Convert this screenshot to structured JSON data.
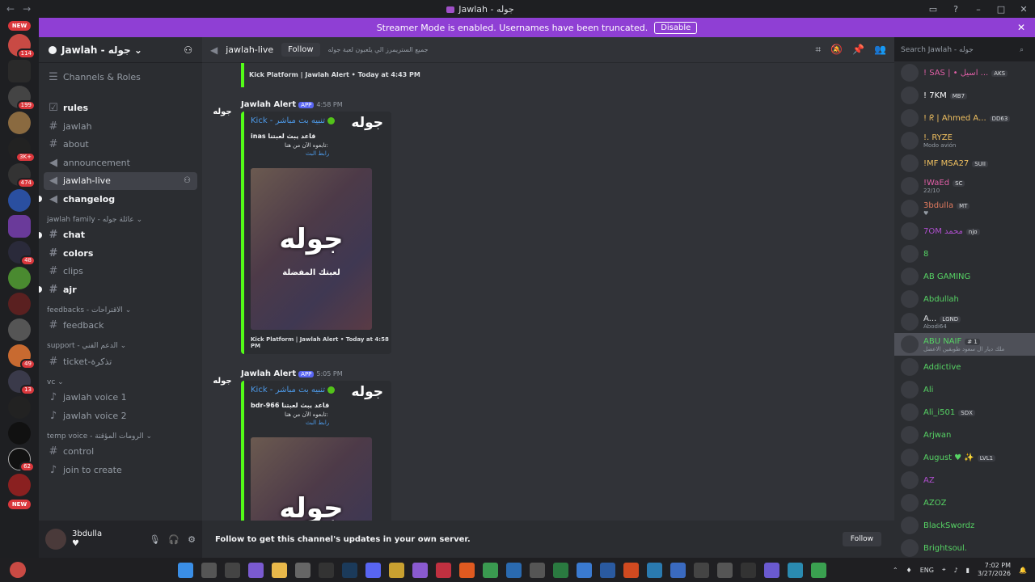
{
  "window": {
    "title": "Jawlah - جوله"
  },
  "banner": {
    "text": "Streamer Mode is enabled. Usernames have been truncated.",
    "button": "Disable"
  },
  "servers": {
    "new_top": "NEW",
    "new_bottom": "NEW",
    "badges": [
      "114",
      "199",
      "3K+",
      "474",
      "48",
      "49",
      "13",
      "62"
    ]
  },
  "guild": {
    "name": "Jawlah - جوله"
  },
  "channels": {
    "top": [
      {
        "label": "Channels & Roles"
      }
    ],
    "list1": [
      "rules",
      "jawlah",
      "about",
      "announcement",
      "jawlah-live",
      "changelog"
    ],
    "cat_family": "jawlah family - عائلة جوله",
    "list2": [
      "chat",
      "colors",
      "clips",
      "ajr"
    ],
    "cat_feedback": "feedbacks - الاقتراحات",
    "feedback": "feedback",
    "cat_support": "support - الدعم الفني",
    "ticket": "ticket-تذكرة",
    "cat_vc": "vc",
    "vc": [
      "jawlah voice 1",
      "jawlah voice 2"
    ],
    "cat_temp": "temp voice - الرومات المؤقتة",
    "temp": [
      "control",
      "join to create"
    ]
  },
  "user": {
    "name": "3bdulla",
    "status": "♥"
  },
  "chat_header": {
    "channel": "jawlah-live",
    "follow": "Follow",
    "topic": "جميع الستريمرز الي يلعبون لعبة جوله"
  },
  "messages": {
    "top_footer": "Kick Platform | Jawlah Alert • Today at 4:43 PM",
    "m1": {
      "author": "Jawlah Alert",
      "app": "APP",
      "time": "4:58 PM",
      "title": "Kick - تنبيه بث مباشر",
      "streamer": "inas",
      "text": "قاعد يبث لعبتنا",
      "text2": "تابعوه الآن من هنا:",
      "link": "رابط البث",
      "thumb": "جوله",
      "image_title": "جوله",
      "image_sub": "لعبتك المفضلة",
      "footer": "Kick Platform | Jawlah Alert • Today at 4:58 PM"
    },
    "m2": {
      "author": "Jawlah Alert",
      "app": "APP",
      "time": "5:05 PM",
      "title": "Kick - تنبيه بث مباشر",
      "streamer": "bdr-966",
      "text": "قاعد يبث لعبتنا",
      "text2": "تابعوه الآن من هنا:",
      "link": "رابط البث",
      "thumb": "جوله",
      "image_title": "جوله"
    },
    "avatar_text": "جوله"
  },
  "followbar": {
    "text": "Follow to get this channel's updates in your own server.",
    "button": "Follow"
  },
  "search": {
    "placeholder": "Search Jawlah - جوله"
  },
  "members": [
    {
      "name": "! SAS | • اسيل ...",
      "tag": "AKS",
      "color": "#e05fa6"
    },
    {
      "name": "! 7KM",
      "tag": "MB7",
      "color": "#ffffff"
    },
    {
      "name": "! ᖇ | Ahmed A...",
      "tag": "DD63",
      "color": "#f0c060"
    },
    {
      "name": "!. RYZE",
      "sub": "Modo avión",
      "color": "#f0c060"
    },
    {
      "name": "!MF MSA27",
      "tag": "SUII",
      "color": "#f0c060"
    },
    {
      "name": "!WaEd",
      "tag": "SC",
      "sub": "22/10",
      "color": "#e05fa6"
    },
    {
      "name": "3bdulla",
      "tag": "MT",
      "sub": "♥",
      "color": "#e07a5f"
    },
    {
      "name": "7OM محمد",
      "tag": "njo",
      "color": "#b04fd0"
    },
    {
      "name": "8",
      "color": "#56d364"
    },
    {
      "name": "AB GAMING",
      "color": "#56d364"
    },
    {
      "name": "Abdullah",
      "color": "#56d364"
    },
    {
      "name": "A...",
      "tag": "LGND",
      "sub": "Abodi64",
      "color": "#dbdee1"
    },
    {
      "name": "ABU NAIF",
      "tag": "# 1",
      "sub": "ملك ديار ال سعود طوبقين الاعضل",
      "color": "#56d364"
    },
    {
      "name": "Addictive",
      "color": "#56d364"
    },
    {
      "name": "Ali",
      "color": "#56d364"
    },
    {
      "name": "Ali_i501",
      "tag": "SDX",
      "color": "#56d364"
    },
    {
      "name": "Arjwan",
      "color": "#56d364"
    },
    {
      "name": "August ♥ ✨",
      "tag": "LVL1",
      "color": "#56d364"
    },
    {
      "name": "AZ",
      "color": "#b04fd0"
    },
    {
      "name": "AZOZ",
      "color": "#56d364"
    },
    {
      "name": "BlackSwordz",
      "color": "#56d364"
    },
    {
      "name": "Brightsoul.",
      "color": "#56d364"
    }
  ],
  "taskbar": {
    "lang": "ENG",
    "time": "7:02 PM",
    "date": "3/27/2026"
  },
  "colors": {
    "accent": "#5865f2",
    "banner": "#8f3fd4",
    "kick": "#53fc18"
  }
}
